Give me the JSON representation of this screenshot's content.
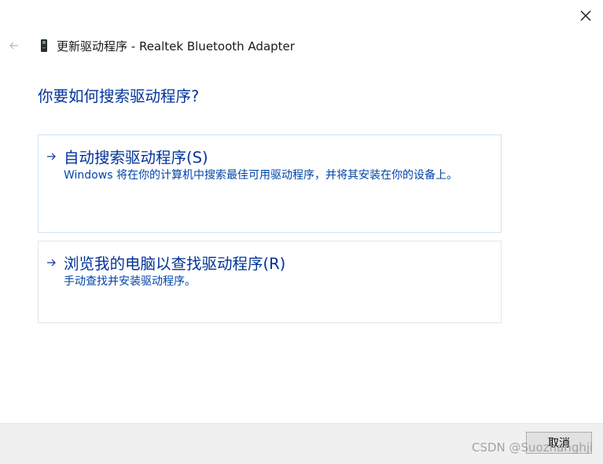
{
  "window": {
    "title": "更新驱动程序 - Realtek Bluetooth Adapter"
  },
  "page": {
    "heading": "你要如何搜索驱动程序?"
  },
  "options": [
    {
      "title": "自动搜索驱动程序(S)",
      "description": "Windows 将在你的计算机中搜索最佳可用驱动程序，并将其安装在你的设备上。"
    },
    {
      "title": "浏览我的电脑以查找驱动程序(R)",
      "description": "手动查找并安装驱动程序。"
    }
  ],
  "footer": {
    "cancel_label": "取消"
  },
  "watermark": "CSDN @Suozhanghji",
  "icons": {
    "close": "close-icon",
    "back": "back-arrow-icon",
    "device": "bluetooth-device-icon",
    "option_arrow": "right-arrow-icon"
  },
  "colors": {
    "heading": "#003399",
    "option_text": "#0044aa",
    "footer_bg": "#f0f0f0",
    "option_border": "#dde8f2"
  }
}
